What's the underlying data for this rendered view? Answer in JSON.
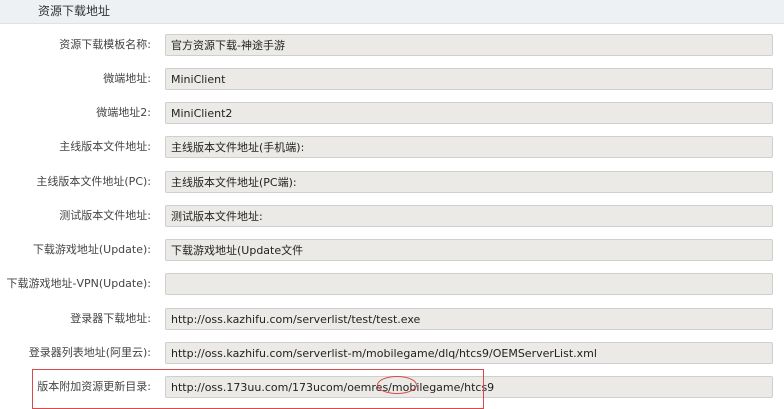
{
  "section": {
    "title": "资源下载地址"
  },
  "rows": [
    {
      "label": "资源下载模板名称:",
      "value": "官方资源下载-神途手游"
    },
    {
      "label": "微端地址:",
      "value": "MiniClient"
    },
    {
      "label": "微端地址2:",
      "value": "MiniClient2"
    },
    {
      "label": "主线版本文件地址:",
      "value": "主线版本文件地址(手机端):"
    },
    {
      "label": "主线版本文件地址(PC):",
      "value": "主线版本文件地址(PC端):"
    },
    {
      "label": "测试版本文件地址:",
      "value": "测试版本文件地址:"
    },
    {
      "label": "下载游戏地址(Update):",
      "value": "下载游戏地址(Update文件"
    },
    {
      "label": "下载游戏地址-VPN(Update):",
      "value": ""
    },
    {
      "label": "登录器下载地址:",
      "value": "http://oss.kazhifu.com/serverlist/test/test.exe"
    },
    {
      "label": "登录器列表地址(阿里云):",
      "value": "http://oss.kazhifu.com/serverlist-m/mobilegame/dlq/htcs9/OEMServerList.xml"
    },
    {
      "label": "版本附加资源更新目录:",
      "value": "http://oss.173uu.com/173ucom/oemres/mobilegame/htcs9"
    }
  ],
  "colors": {
    "annotation": "#d94b4b",
    "input_bg": "#ebeae6",
    "header_bg": "#eef1f4"
  }
}
